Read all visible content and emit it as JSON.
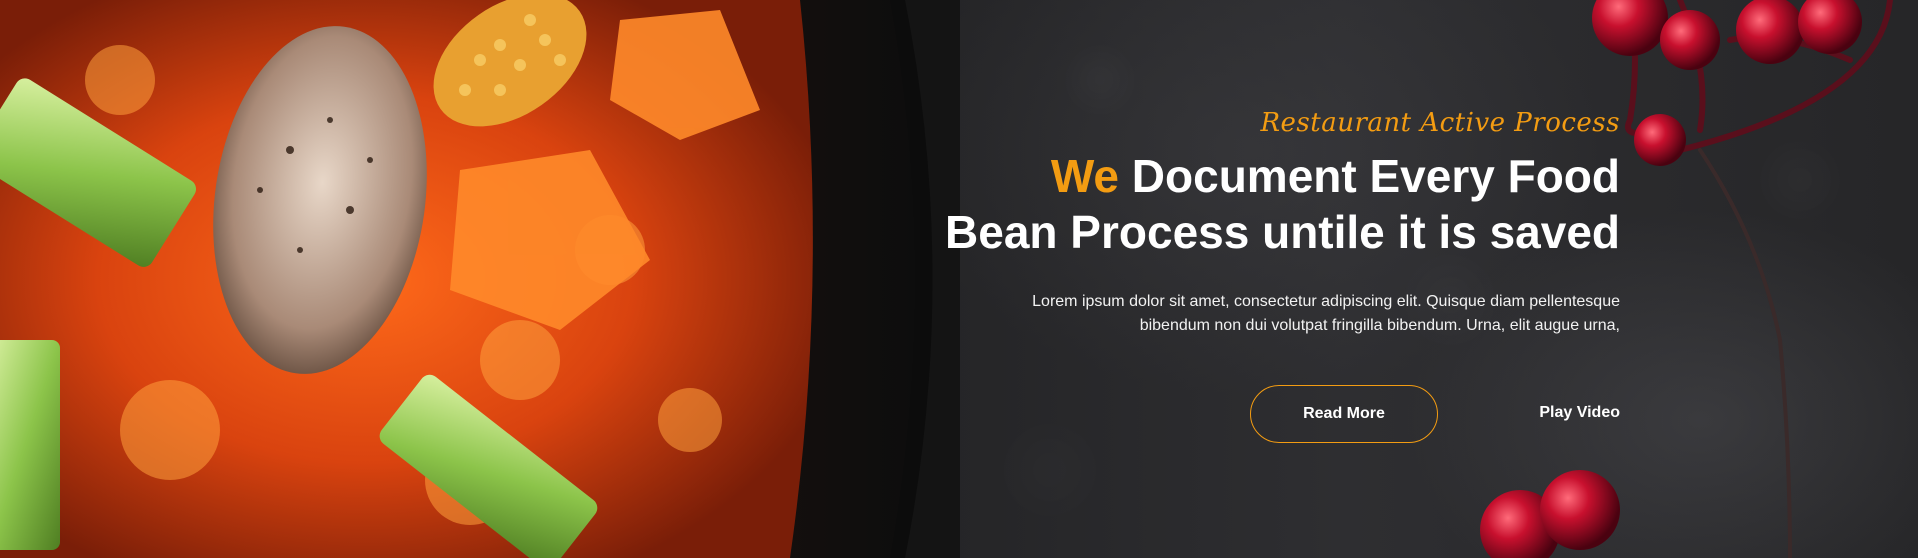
{
  "hero": {
    "tagline": "Restaurant Active Process",
    "headline_accent": "We",
    "headline_line1_rest": "Document Every Food",
    "headline_line2": "Bean Process untile it is saved",
    "paragraph_line1": "Lorem ipsum dolor sit amet, consectetur adipiscing elit. Quisque diam pellentesque",
    "paragraph_line2": "bibendum non dui volutpat fringilla bibendum. Urna, elit augue urna,",
    "read_more_label": "Read More",
    "play_video_label": "Play Video"
  },
  "colors": {
    "accent": "#f39c12",
    "text": "#ffffff",
    "background": "#2a2a2c"
  },
  "images": {
    "left": "food-dish-image",
    "right": "red-berries-image"
  }
}
